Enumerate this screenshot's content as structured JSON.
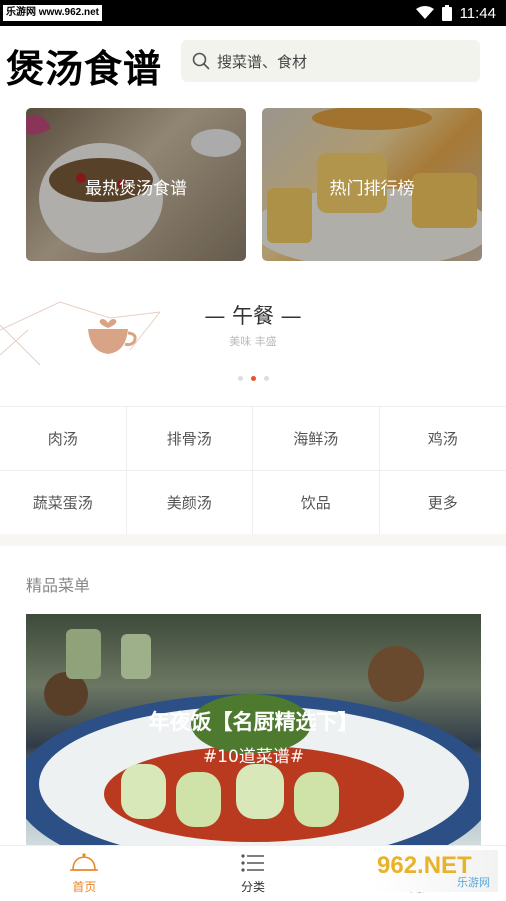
{
  "status_bar": {
    "site": "乐游网 www.962.net",
    "time": "11:44"
  },
  "header": {
    "title": "煲汤食谱",
    "search_placeholder": "搜菜谱、食材"
  },
  "cards": [
    {
      "label": "最热煲汤食谱"
    },
    {
      "label": "热门排行榜"
    }
  ],
  "banner": {
    "title": "— 午餐 —",
    "subtitle": "美味 丰盛",
    "dots": 3,
    "active_dot": 1
  },
  "categories": [
    "肉汤",
    "排骨汤",
    "海鲜汤",
    "鸡汤",
    "蔬菜蛋汤",
    "美颜汤",
    "饮品",
    "更多"
  ],
  "section": {
    "title": "精品菜单"
  },
  "featured": {
    "title": "年夜饭【名厨精选下】",
    "subtitle": "#10道菜谱#"
  },
  "bottom_nav": [
    {
      "label": "首页",
      "icon": "chef-hat-icon",
      "active": true
    },
    {
      "label": "分类",
      "icon": "list-icon",
      "active": false
    },
    {
      "label": "更多",
      "icon": "more-icon",
      "active": false
    }
  ],
  "watermark": {
    "logo": "962.NET",
    "sub": "乐游网"
  },
  "colors": {
    "accent": "#e8882a",
    "dot_active": "#e8542a",
    "search_bg": "#f3f3ee"
  }
}
